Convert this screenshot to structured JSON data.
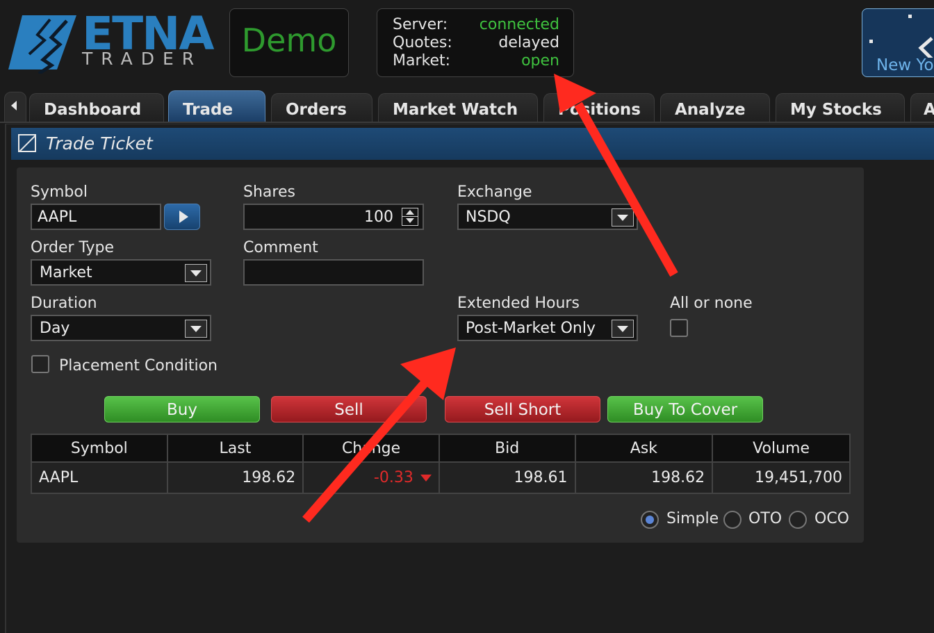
{
  "header": {
    "logo_text": "ETNA",
    "logo_sub": "TRADER",
    "mode_label": "Demo",
    "status": [
      {
        "label": "Server:",
        "value": "connected",
        "color": "#3fc23f"
      },
      {
        "label": "Quotes:",
        "value": "delayed",
        "color": "#e8e8e8"
      },
      {
        "label": "Market:",
        "value": "open",
        "color": "#3fc23f"
      }
    ],
    "clock_label": "New Yo"
  },
  "tabs": [
    {
      "label": "Dashboard",
      "active": false
    },
    {
      "label": "Trade",
      "active": true
    },
    {
      "label": "Orders",
      "active": false
    },
    {
      "label": "Market Watch",
      "active": false
    },
    {
      "label": "Positions",
      "active": false
    },
    {
      "label": "Analyze",
      "active": false
    },
    {
      "label": "My Stocks",
      "active": false
    },
    {
      "label": "A",
      "active": false
    }
  ],
  "ticket": {
    "title": "Trade Ticket",
    "symbol_label": "Symbol",
    "symbol_value": "AAPL",
    "shares_label": "Shares",
    "shares_value": "100",
    "exchange_label": "Exchange",
    "exchange_value": "NSDQ",
    "order_type_label": "Order Type",
    "order_type_value": "Market",
    "comment_label": "Comment",
    "comment_value": "",
    "duration_label": "Duration",
    "duration_value": "Day",
    "extended_hours_label": "Extended Hours",
    "extended_hours_value": "Post-Market Only",
    "all_or_none_label": "All or none",
    "all_or_none_checked": false,
    "placement_condition_label": "Placement Condition",
    "placement_condition_checked": false
  },
  "actions": {
    "buy": "Buy",
    "sell": "Sell",
    "sell_short": "Sell Short",
    "buy_to_cover": "Buy To Cover"
  },
  "quote_table": {
    "headers": [
      "Symbol",
      "Last",
      "Change",
      "Bid",
      "Ask",
      "Volume"
    ],
    "row": {
      "symbol": "AAPL",
      "last": "198.62",
      "change": "-0.33",
      "bid": "198.61",
      "ask": "198.62",
      "volume": "19,451,700"
    }
  },
  "order_modes": [
    {
      "label": "Simple",
      "selected": true
    },
    {
      "label": "OTO",
      "selected": false
    },
    {
      "label": "OCO",
      "selected": false
    }
  ],
  "colors": {
    "annotation_arrow": "#ff2a1f",
    "accent_blue": "#2a7fbf",
    "positive_green": "#3fc23f",
    "negative_red": "#e02a2a"
  }
}
